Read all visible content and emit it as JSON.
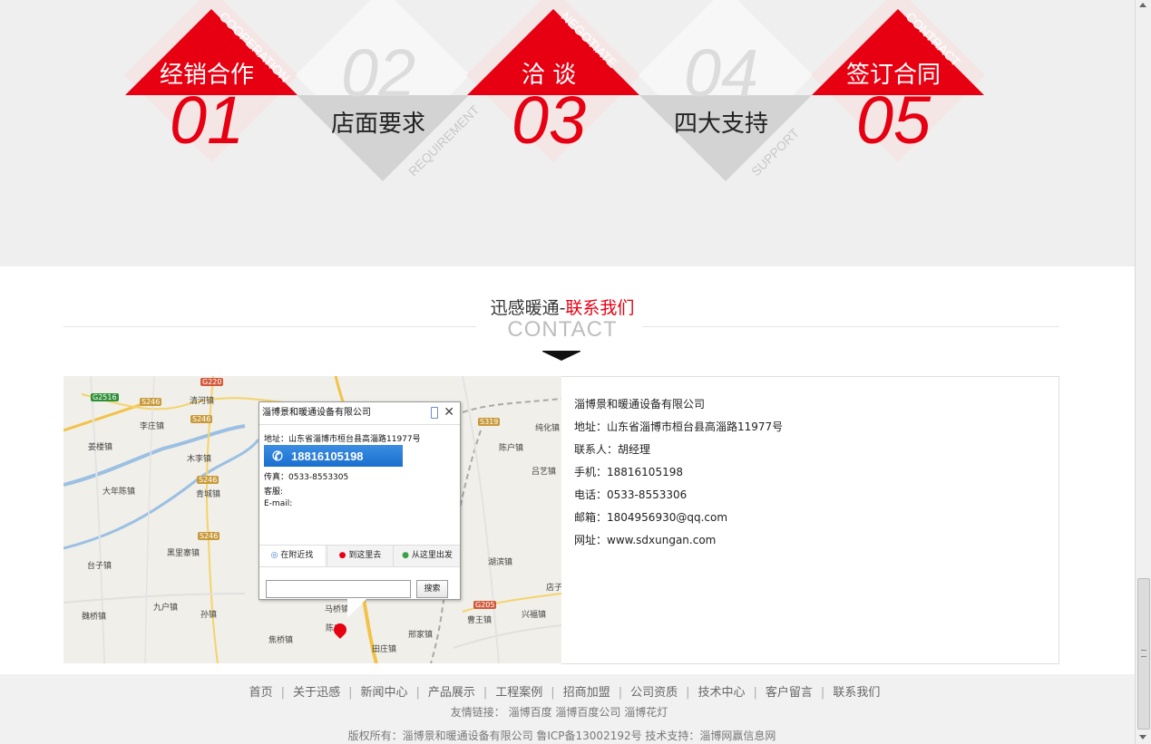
{
  "steps": [
    {
      "title": "经销合作",
      "num": "01",
      "en": "COOPERATION",
      "style": "red"
    },
    {
      "title": "店面要求",
      "num": "02",
      "en": "REQUIREMENT",
      "style": "grey"
    },
    {
      "title": "洽  谈",
      "num": "03",
      "en": "NEGOTIATE",
      "style": "red"
    },
    {
      "title": "四大支持",
      "num": "04",
      "en": "SUPPORT",
      "style": "grey"
    },
    {
      "title": "签订合同",
      "num": "05",
      "en": "CONTRACT",
      "style": "red"
    }
  ],
  "contact": {
    "title_prefix": "迅感暖通-",
    "title_highlight": "联系我们",
    "subtitle": "CONTACT"
  },
  "map": {
    "towns": [
      "清河镇",
      "李庄镇",
      "姜楼镇",
      "大年陈镇",
      "青城镇",
      "黑里寨镇",
      "台子镇",
      "九户镇",
      "魏桥镇",
      "孙镇",
      "焦桥镇",
      "木李镇",
      "陈户镇",
      "吕艺镇",
      "纯化镇",
      "湖滨镇",
      "店子",
      "兴福镇",
      "曹王镇",
      "马桥镇",
      "邢家镇",
      "田庄镇",
      "陈庄"
    ],
    "roads": [
      "G2516",
      "S246",
      "S246",
      "S246",
      "S246",
      "G220",
      "S319",
      "G205"
    ],
    "popup": {
      "title": "淄博景和暖通设备有限公司",
      "address": "地址：山东省淄博市桓台县高淄路11977号",
      "phone": "18816105198",
      "fax": "传真：0533-8553305",
      "service": "客服:",
      "email": "E-mail:",
      "tab_nearby": "在附近找",
      "tab_goto": "到这里去",
      "tab_from": "从这里出发",
      "search_button": "搜索",
      "search_value": ""
    }
  },
  "info": {
    "company": "淄博景和暖通设备有限公司",
    "address": "地址：山东省淄博市桓台县高淄路11977号",
    "contact": "联系人：胡经理",
    "mobile": "手机：18816105198",
    "tel": "电话：0533-8553306",
    "email": "邮箱：1804956930@qq.com",
    "website": "网址：www.sdxungan.com"
  },
  "footer": {
    "nav": [
      "首页",
      "关于迅感",
      "新闻中心",
      "产品展示",
      "工程案例",
      "招商加盟",
      "公司资质",
      "技术中心",
      "客户留言",
      "联系我们"
    ],
    "links": "友情链接： 淄博百度 淄博百度公司 淄博花灯",
    "copyright": "版权所有：淄博景和暖通设备有限公司 鲁ICP备13002192号 技术支持：淄博网赢信息网"
  },
  "colors": {
    "accent": "#e60012",
    "grey_diamond": "#d3d3d3"
  }
}
